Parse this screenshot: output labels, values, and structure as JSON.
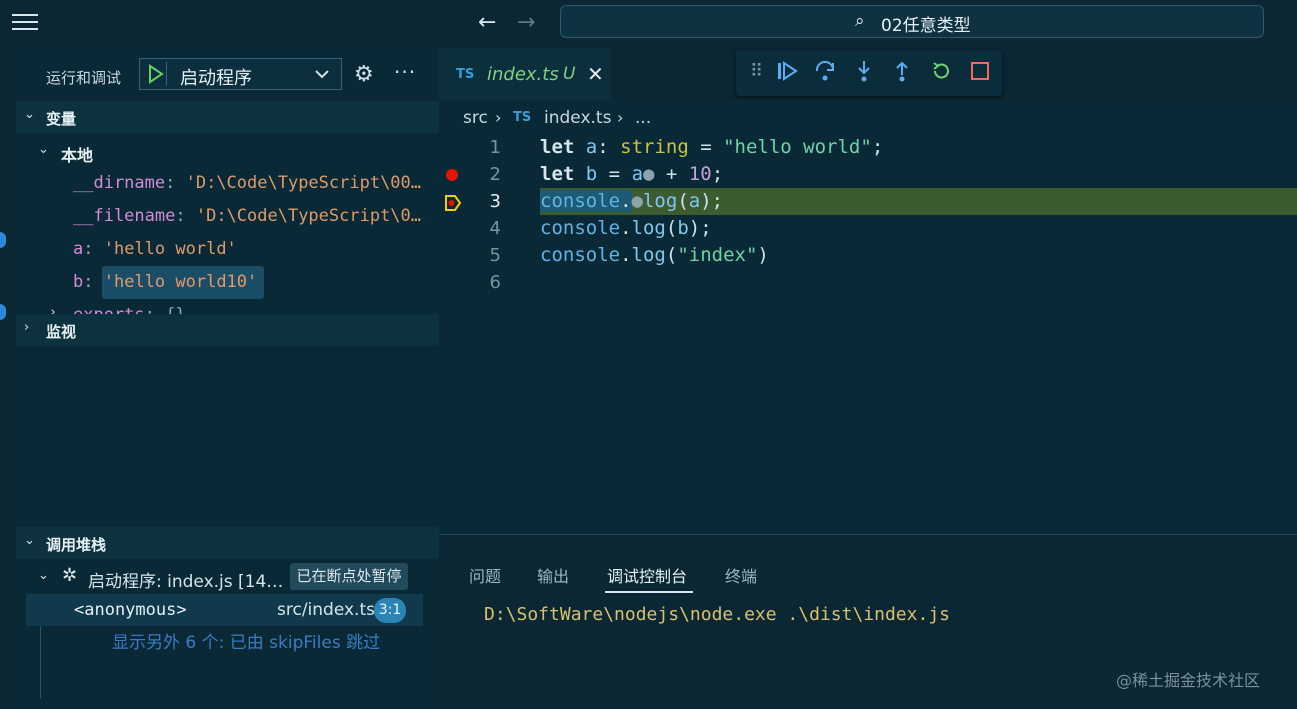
{
  "window": {
    "search_text": "02任意类型"
  },
  "sidebar": {
    "title": "运行和调试",
    "launch_config": "启动程序",
    "variables_section": "变量",
    "locals_section": "本地",
    "variables": [
      {
        "name": "__dirname",
        "value": "'D:\\Code\\TypeScript\\00…"
      },
      {
        "name": "__filename",
        "value": "'D:\\Code\\TypeScript\\0…"
      },
      {
        "name": "a",
        "value": "'hello world'"
      },
      {
        "name": "b",
        "value": "'hello world10'"
      },
      {
        "name": "exports",
        "value": "{}"
      }
    ],
    "watch_section": "监视",
    "callstack_section": "调用堆栈",
    "session_label": "启动程序: index.js [14…",
    "session_status": "已在断点处暂停",
    "frame_name": "<anonymous>",
    "frame_file": "src/index.ts",
    "frame_position": "3:1",
    "skip_text": "显示另外 6 个: 已由 skipFiles 跳过"
  },
  "editor": {
    "tab_lang": "TS",
    "tab_filename": "index.ts",
    "tab_status": "U",
    "breadcrumb": {
      "folder": "src",
      "lang": "TS",
      "file": "index.ts",
      "rest": "..."
    },
    "line_numbers": [
      "1",
      "2",
      "3",
      "4",
      "5",
      "6"
    ],
    "lines": {
      "l1": {
        "kw": "let",
        "var": "a",
        "colon": ": ",
        "type": "string",
        "eq": " = ",
        "str": "\"hello world\"",
        "end": ";"
      },
      "l2": {
        "kw": "let",
        "var": "b",
        "eq": " = ",
        "ref": "a",
        "op": " + ",
        "num": "10",
        "end": ";"
      },
      "l3": {
        "obj": "console",
        "dot": ".",
        "fn": "log",
        "open": "(",
        "arg": "a",
        "close": ");"
      },
      "l4": {
        "obj": "console",
        "dot": ".",
        "fn": "log",
        "open": "(",
        "arg": "b",
        "close": ");"
      },
      "l5": {
        "obj": "console",
        "dot": ".",
        "fn": "log",
        "open": "(",
        "arg": "\"index\"",
        "close": ")"
      }
    }
  },
  "panel": {
    "tabs": [
      "问题",
      "输出",
      "调试控制台",
      "终端"
    ],
    "active_tab": "调试控制台",
    "console_output": "D:\\SoftWare\\nodejs\\node.exe .\\dist\\index.js"
  },
  "watermark": "@稀土掘金技术社区",
  "colors": {
    "accent": "#2b84b6",
    "current_line": "#3c5b30",
    "breakpoint": "#e51400",
    "string": "#6fd3a8"
  }
}
